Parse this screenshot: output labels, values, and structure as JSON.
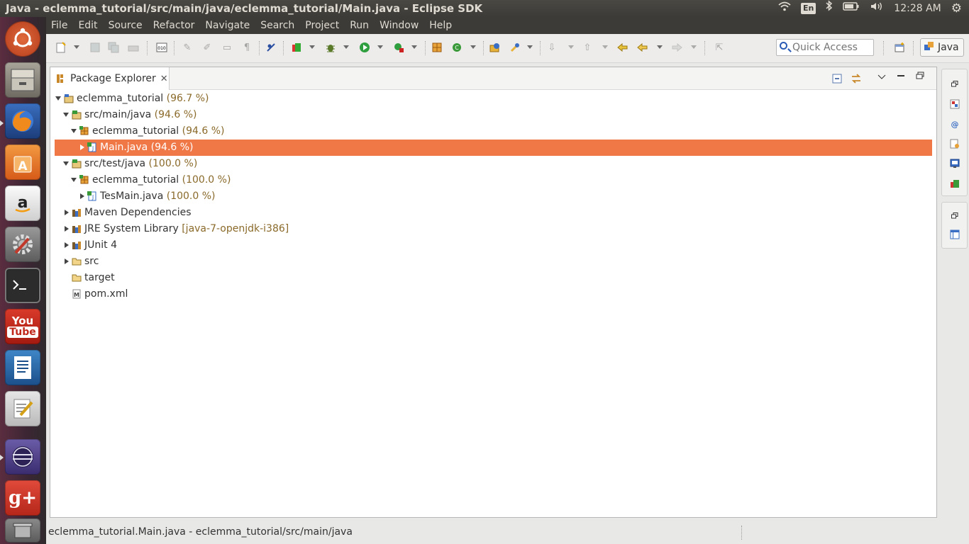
{
  "window": {
    "title": "Java - eclemma_tutorial/src/main/java/eclemma_tutorial/Main.java - Eclipse SDK"
  },
  "indicators": {
    "keyboard": "En",
    "time": "12:28 AM"
  },
  "launcher": {
    "youtube_top": "You",
    "youtube_bottom": "Tube",
    "gplus": "g+"
  },
  "menu": [
    "File",
    "Edit",
    "Source",
    "Refactor",
    "Navigate",
    "Search",
    "Project",
    "Run",
    "Window",
    "Help"
  ],
  "toolbar": {
    "quick_access_placeholder": "Quick Access",
    "perspective_label": "Java"
  },
  "view": {
    "tab_label": "Package Explorer"
  },
  "tree": [
    {
      "label": "eclemma_tutorial",
      "suffix": "(96.7 %)"
    },
    {
      "label": "src/main/java",
      "suffix": "(94.6 %)"
    },
    {
      "label": "eclemma_tutorial",
      "suffix": "(94.6 %)"
    },
    {
      "label": "Main.java",
      "suffix": "(94.6 %)"
    },
    {
      "label": "src/test/java",
      "suffix": "(100.0 %)"
    },
    {
      "label": "eclemma_tutorial",
      "suffix": "(100.0 %)"
    },
    {
      "label": "TesMain.java",
      "suffix": "(100.0 %)"
    },
    {
      "label": "Maven Dependencies",
      "suffix": ""
    },
    {
      "label": "JRE System Library",
      "suffix": "[java-7-openjdk-i386]"
    },
    {
      "label": "JUnit 4",
      "suffix": ""
    },
    {
      "label": "src",
      "suffix": ""
    },
    {
      "label": "target",
      "suffix": ""
    },
    {
      "label": "pom.xml",
      "suffix": ""
    }
  ],
  "status": {
    "text": "eclemma_tutorial.Main.java - eclemma_tutorial/src/main/java"
  },
  "colors": {
    "selection": "#f07746",
    "coverage_text": "#8a6a2a"
  }
}
